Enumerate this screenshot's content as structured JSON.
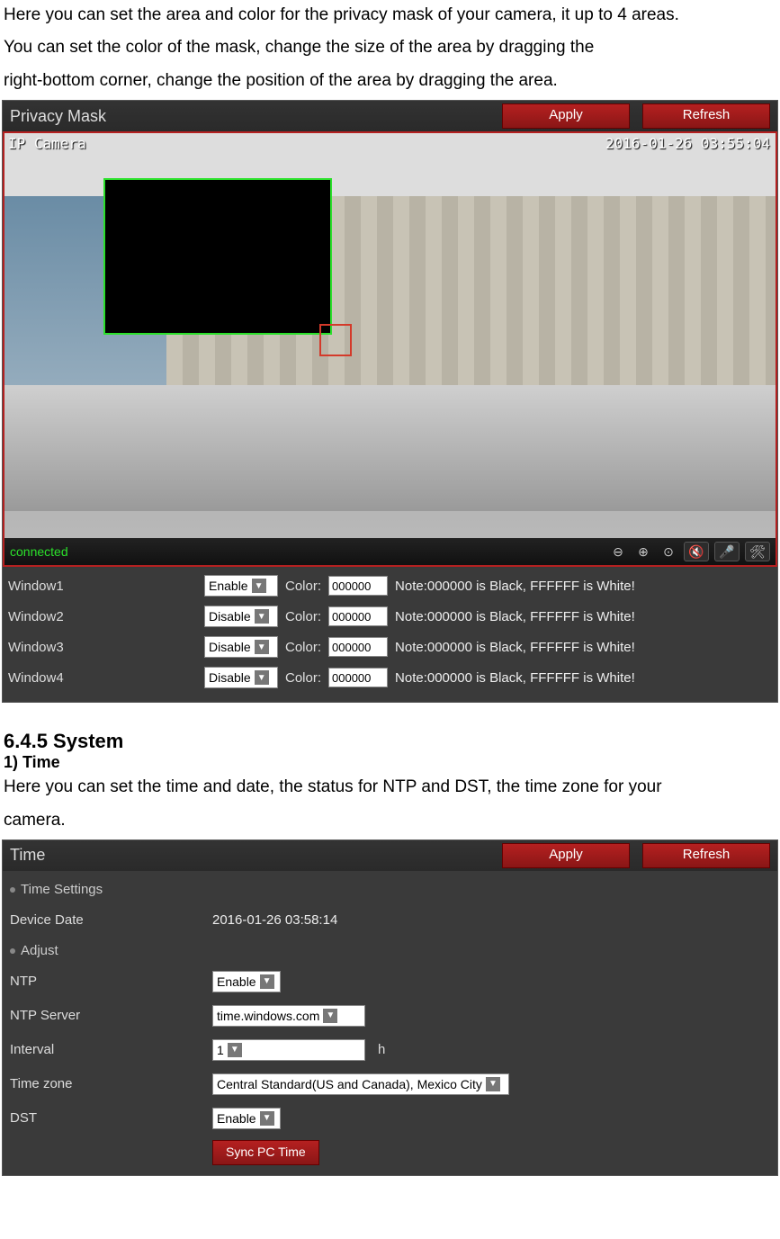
{
  "intro": {
    "line1": "Here you can set the area and color for the privacy mask of your camera, it up to 4 areas.",
    "line2": "You can set the color of the mask, change the size of the area by dragging the",
    "line3": "right-bottom corner, change the position of the area by dragging the area."
  },
  "privacy_panel": {
    "title": "Privacy Mask",
    "apply": "Apply",
    "refresh": "Refresh",
    "overlay_label": "IP Camera",
    "overlay_time": "2016-01-26 03:55:04",
    "status": "connected",
    "icons": {
      "zoom_out": "⊖",
      "zoom_in": "⊕",
      "center": "⊙",
      "mute": "🔇",
      "mic_off": "🎤",
      "tools": "🛠"
    },
    "windows": [
      {
        "label": "Window1",
        "enable": "Enable",
        "color_label": "Color:",
        "color": "000000",
        "note": "Note:000000 is Black, FFFFFF is White!"
      },
      {
        "label": "Window2",
        "enable": "Disable",
        "color_label": "Color:",
        "color": "000000",
        "note": "Note:000000 is Black, FFFFFF is White!"
      },
      {
        "label": "Window3",
        "enable": "Disable",
        "color_label": "Color:",
        "color": "000000",
        "note": "Note:000000 is Black, FFFFFF is White!"
      },
      {
        "label": "Window4",
        "enable": "Disable",
        "color_label": "Color:",
        "color": "000000",
        "note": "Note:000000 is Black, FFFFFF is White!"
      }
    ]
  },
  "section": {
    "heading": "6.4.5 System",
    "sub": "1) Time",
    "desc1": "Here you can set the time and date, the status for NTP and DST, the time zone for your",
    "desc2": "camera."
  },
  "time_panel": {
    "title": "Time",
    "apply": "Apply",
    "refresh": "Refresh",
    "sub_settings": "Time Settings",
    "device_date_label": "Device Date",
    "device_date_value": "2016-01-26 03:58:14",
    "sub_adjust": "Adjust",
    "ntp_label": "NTP",
    "ntp_value": "Enable",
    "ntp_server_label": "NTP Server",
    "ntp_server_value": "time.windows.com",
    "interval_label": "Interval",
    "interval_value": "1",
    "interval_unit": "h",
    "timezone_label": "Time zone",
    "timezone_value": "Central Standard(US and Canada), Mexico City",
    "dst_label": "DST",
    "dst_value": "Enable",
    "sync_btn": "Sync PC Time"
  }
}
